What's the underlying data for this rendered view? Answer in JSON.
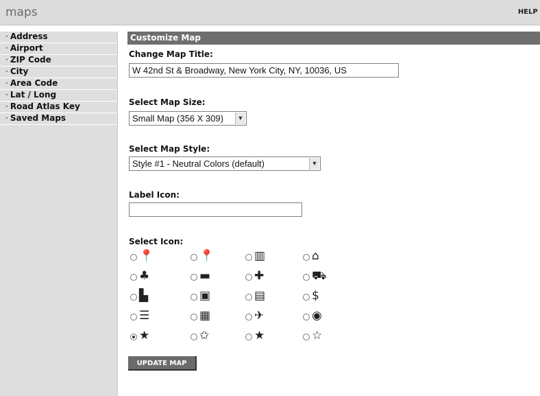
{
  "app": {
    "logo": "maps",
    "help": "HELP ?"
  },
  "sidebar": {
    "items": [
      {
        "label": "Address"
      },
      {
        "label": "Airport"
      },
      {
        "label": "ZIP Code"
      },
      {
        "label": "City"
      },
      {
        "label": "Area Code"
      },
      {
        "label": "Lat / Long"
      },
      {
        "label": "Road Atlas Key"
      },
      {
        "label": "Saved Maps"
      }
    ]
  },
  "form": {
    "header": "Customize Map",
    "title_label": "Change Map Title:",
    "title_value": "W 42nd St & Broadway, New York City, NY, 10036, US",
    "size_label": "Select Map Size:",
    "size_value": "Small Map (356 X 309)",
    "style_label": "Select Map Style:",
    "style_value": "Style #1 - Neutral Colors (default)",
    "label_icon_label": "Label Icon:",
    "label_icon_value": "",
    "select_icon_label": "Select Icon:",
    "selected_icon": "star-filled-small",
    "icons": [
      [
        "pushpin-icon",
        "pushpin-icon",
        "building-icon",
        "house-icon"
      ],
      [
        "tree-icon",
        "briefcase-icon",
        "medical-cross-icon",
        "car-icon"
      ],
      [
        "shopping-bag-icon",
        "camera-icon",
        "restaurant-icon",
        "money-icon"
      ],
      [
        "train-icon",
        "bus-icon",
        "airplane-icon",
        "globe-icon"
      ],
      [
        "star-filled-small",
        "star-outline-bold",
        "star-filled-large",
        "star-outline"
      ]
    ],
    "update_button": "UPDATE MAP"
  }
}
